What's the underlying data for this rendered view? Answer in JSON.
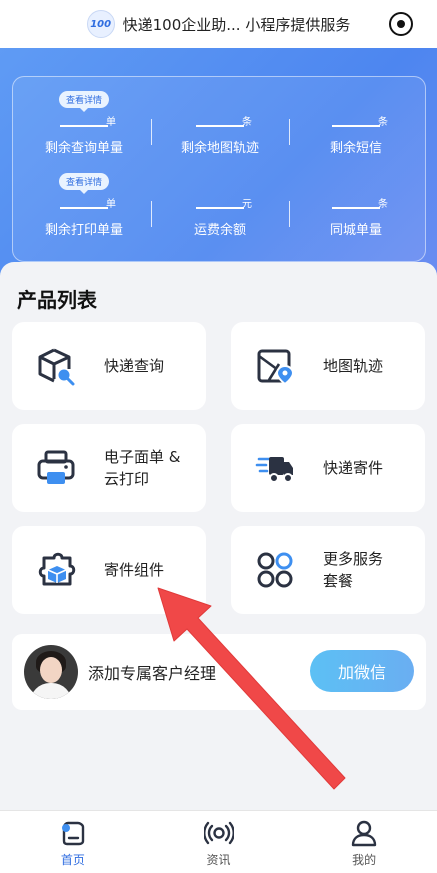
{
  "header": {
    "logo_text": "100",
    "title": "快递100企业助... 小程序提供服务"
  },
  "stats": {
    "row1": [
      {
        "unit": "单",
        "label": "剩余查询单量",
        "badge": "查看详情"
      },
      {
        "unit": "条",
        "label": "剩余地图轨迹"
      },
      {
        "unit": "条",
        "label": "剩余短信"
      }
    ],
    "row2": [
      {
        "unit": "单",
        "label": "剩余打印单量",
        "badge": "查看详情"
      },
      {
        "unit": "元",
        "label": "运费余额"
      },
      {
        "unit": "条",
        "label": "同城单量"
      }
    ]
  },
  "products": {
    "title": "产品列表",
    "items": [
      {
        "line1": "快递查询",
        "line2": "",
        "icon": "package-search-icon"
      },
      {
        "line1": "地图轨迹",
        "line2": "",
        "icon": "map-pin-icon"
      },
      {
        "line1": "电子面单 &",
        "line2": "云打印",
        "icon": "printer-icon"
      },
      {
        "line1": "快递寄件",
        "line2": "",
        "icon": "delivery-truck-icon"
      },
      {
        "line1": "寄件组件",
        "line2": "",
        "icon": "puzzle-box-icon"
      },
      {
        "line1": "更多服务",
        "line2": "套餐",
        "icon": "grid-more-icon"
      }
    ]
  },
  "manager": {
    "text": "添加专属客户经理",
    "button": "加微信"
  },
  "tabbar": {
    "tabs": [
      {
        "label": "首页",
        "active": true
      },
      {
        "label": "资讯",
        "active": false
      },
      {
        "label": "我的",
        "active": false
      }
    ]
  },
  "colors": {
    "brand_blue": "#2f6de0",
    "hero_start": "#5f9bf4",
    "hero_end": "#6d8df1",
    "icon_dark": "#2b3242",
    "icon_accent": "#3e8ff0",
    "annotation_arrow": "#f04848"
  }
}
